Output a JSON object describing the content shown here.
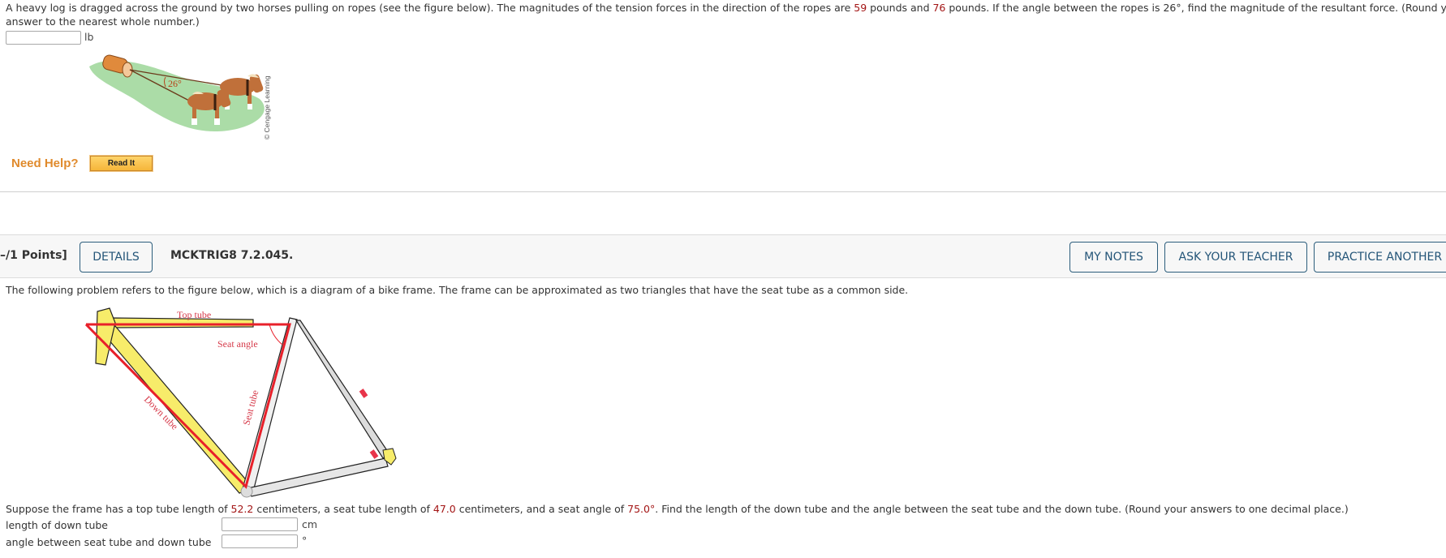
{
  "question1": {
    "text_part1": "A heavy log is dragged across the ground by two horses pulling on ropes (see the figure below). The magnitudes of the tension forces in the direction of the ropes are ",
    "value1": "59",
    "text_part2": " pounds and ",
    "value2": "76",
    "text_part3": " pounds. If the angle between the ropes is 26°, find the magnitude of the resultant force. (Round your",
    "text_line2": "answer to the nearest whole number.)",
    "answer_value": "",
    "answer_unit": "lb",
    "figure": {
      "angle_label": "26°",
      "credit": "© Cengage Learning"
    },
    "help": {
      "label": "Need Help?",
      "read_it_button": "Read It"
    }
  },
  "question2": {
    "header": {
      "points": "–/1 Points]",
      "details_button": "DETAILS",
      "question_id": "MCKTRIG8 7.2.045.",
      "my_notes_button": "MY NOTES",
      "ask_teacher_button": "ASK YOUR TEACHER",
      "practice_button": "PRACTICE ANOTHER"
    },
    "intro": "The following problem refers to the figure below, which is a diagram of a bike frame. The frame can be approximated as two triangles that have the seat tube as a common side.",
    "figure": {
      "top_tube_label": "Top tube",
      "seat_angle_label": "Seat angle",
      "seat_tube_label": "Seat tube",
      "down_tube_label": "Down tube"
    },
    "body_part1": "Suppose the frame has a top tube length of ",
    "top_tube_length": "52.2",
    "body_part2": " centimeters, a seat tube length of ",
    "seat_tube_length": "47.0",
    "body_part3": " centimeters, and a seat angle of ",
    "seat_angle": "75.0°",
    "body_part4": ". Find the length of the down tube and the angle between the seat tube and the down tube. (Round your answers to one decimal place.)",
    "answers": [
      {
        "label": "length of down tube",
        "value": "",
        "unit": "cm"
      },
      {
        "label": "angle between seat tube and down tube",
        "value": "",
        "unit": "°"
      }
    ]
  }
}
